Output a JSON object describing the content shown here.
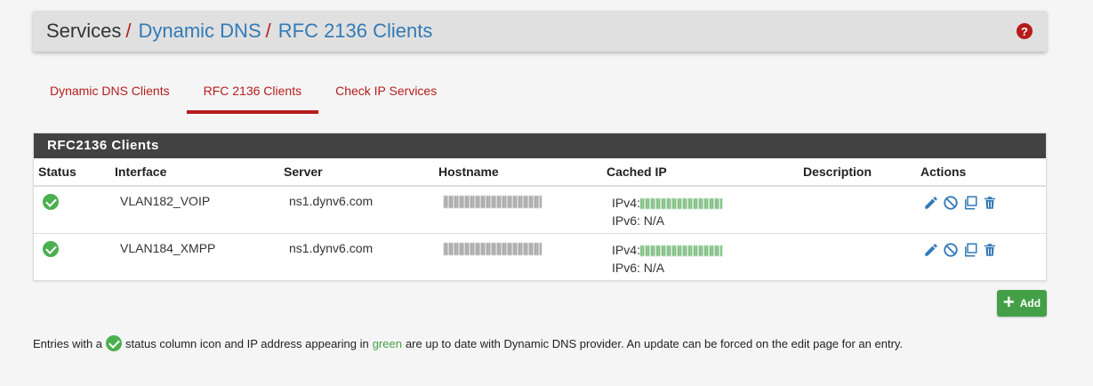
{
  "breadcrumb": {
    "root": "Services",
    "sep": "/",
    "items": [
      "Dynamic DNS",
      "RFC 2136 Clients"
    ]
  },
  "tabs": [
    {
      "label": "Dynamic DNS Clients",
      "active": false
    },
    {
      "label": "RFC 2136 Clients",
      "active": true
    },
    {
      "label": "Check IP Services",
      "active": false
    }
  ],
  "panel": {
    "title": "RFC2136 Clients",
    "columns": [
      "Status",
      "Interface",
      "Server",
      "Hostname",
      "Cached IP",
      "Description",
      "Actions"
    ],
    "rows": [
      {
        "interface": "VLAN182_VOIP",
        "server": "ns1.dynv6.com",
        "ipv4_label": "IPv4:",
        "ipv6": "IPv6: N/A"
      },
      {
        "interface": "VLAN184_XMPP",
        "server": "ns1.dynv6.com",
        "ipv4_label": "IPv4:",
        "ipv6": "IPv6: N/A"
      }
    ]
  },
  "add_button": {
    "label": "Add"
  },
  "footnote": {
    "part1": "Entries with a",
    "part2": "status column icon and IP address appearing in",
    "green": "green",
    "part3": "are up to date with Dynamic DNS provider. An update can be forced on the edit page for an entry."
  },
  "colors": {
    "accent": "#b71c1c",
    "link": "#337ab7",
    "success": "#43a047",
    "action": "#337ab7"
  },
  "icons": {
    "status": "check-circle-icon",
    "help": "question-circle-icon",
    "edit": "pencil-icon",
    "disable": "ban-icon",
    "copy": "clone-icon",
    "delete": "trash-icon",
    "add": "plus-icon"
  }
}
